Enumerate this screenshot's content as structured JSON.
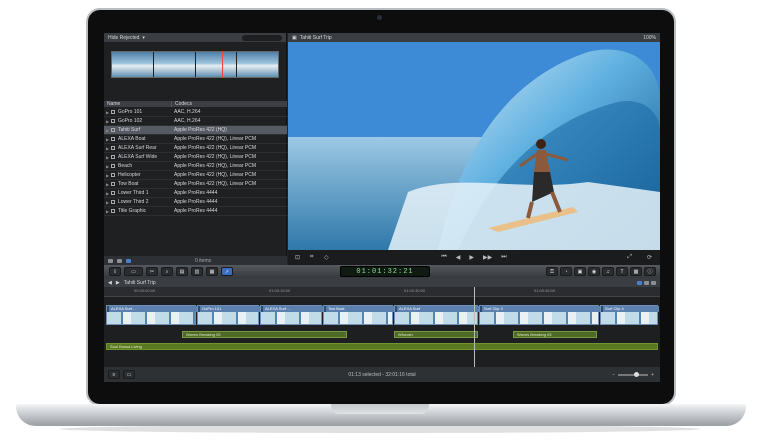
{
  "browser": {
    "filter_label": "Hide Rejected",
    "columns": {
      "name": "Name",
      "codecs": "Codecs"
    },
    "rows": [
      {
        "name": "GoPro 101",
        "codec": "AAC, H.264",
        "selected": false
      },
      {
        "name": "GoPro 102",
        "codec": "AAC, H.264",
        "selected": false
      },
      {
        "name": "Tahiti Surf",
        "codec": "Apple ProRes 422 (HQ)",
        "selected": true
      },
      {
        "name": "ALEXA Boat",
        "codec": "Apple ProRes 422 (HQ), Linear PCM",
        "selected": false
      },
      {
        "name": "ALEXA Surf Rear",
        "codec": "Apple ProRes 422 (HQ), Linear PCM",
        "selected": false
      },
      {
        "name": "ALEXA Surf Wide",
        "codec": "Apple ProRes 422 (HQ), Linear PCM",
        "selected": false
      },
      {
        "name": "Beach",
        "codec": "Apple ProRes 422 (HQ), Linear PCM",
        "selected": false
      },
      {
        "name": "Helicopter",
        "codec": "Apple ProRes 422 (HQ), Linear PCM",
        "selected": false
      },
      {
        "name": "Tow Boat",
        "codec": "Apple ProRes 422 (HQ), Linear PCM",
        "selected": false
      },
      {
        "name": "Lower Third 1",
        "codec": "Apple ProRes 4444",
        "selected": false
      },
      {
        "name": "Lower Third 2",
        "codec": "Apple ProRes 4444",
        "selected": false
      },
      {
        "name": "Title Graphic",
        "codec": "Apple ProRes 4444",
        "selected": false
      }
    ],
    "footer_items": "0 items"
  },
  "viewer": {
    "title": "Tahiti Surf Trip",
    "zoom": "100%"
  },
  "toolbar": {
    "timecode": "01:01:32:21"
  },
  "timeline": {
    "title": "Tahiti Surf Trip",
    "ruler": [
      "00:00:00:00",
      "01:00:15:00",
      "01:00:30:00",
      "01:00:45:00"
    ],
    "clips": [
      {
        "label": "ALEXA Surf ..."
      },
      {
        "label": "GoPro 101"
      },
      {
        "label": "ALEXA Surf ..."
      },
      {
        "label": "Tow Boat"
      },
      {
        "label": "ALEXA Surf"
      },
      {
        "label": "Surf Clip 3"
      },
      {
        "label": "Surf Clip 4"
      }
    ],
    "audio": [
      {
        "label": "Waves Breaking 03"
      },
      {
        "label": "Whoosh"
      },
      {
        "label": "Waves Breaking 03"
      }
    ],
    "music": "Soul Bossa Living"
  },
  "status": {
    "text": "01:13 selected - 32:01:16 total"
  },
  "colors": {
    "bezel": "#0d0d0e",
    "timecode": "#8fe08f",
    "video_clip": "#5b7fae",
    "audio_clip": "#5a7a22"
  }
}
